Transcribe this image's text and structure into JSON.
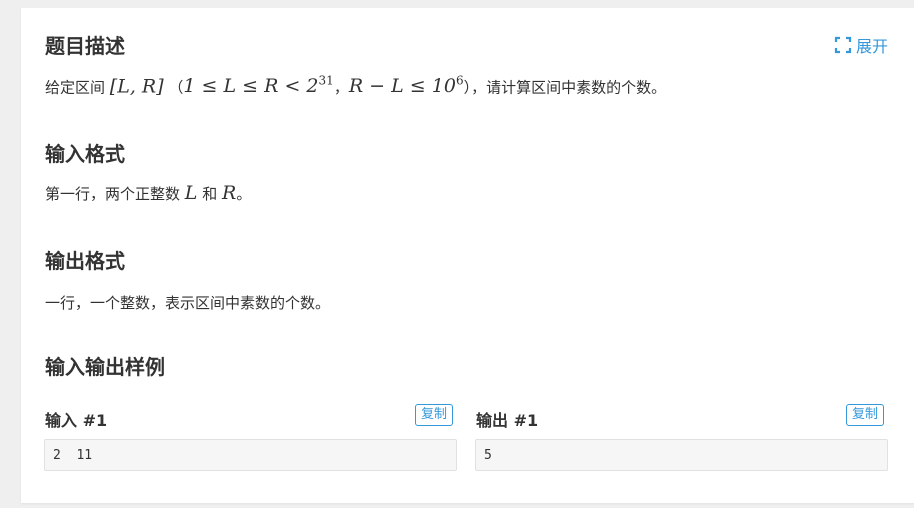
{
  "expand_label": "展开",
  "sections": {
    "description": {
      "title": "题目描述",
      "text_prefix": "给定区间",
      "math_interval": "[L, R]",
      "cond_open": "（",
      "cond_math_1": "1 ≤ L ≤ R < 2",
      "cond_exp_1": "31",
      "cond_sep": "，",
      "cond_math_2": "R − L ≤ 10",
      "cond_exp_2": "6",
      "cond_close": "），",
      "text_suffix": "请计算区间中素数的个数。"
    },
    "input_format": {
      "title": "输入格式",
      "text_prefix": "第一行，两个正整数",
      "var_l": "L",
      "and": "和",
      "var_r": "R",
      "text_suffix": "。"
    },
    "output_format": {
      "title": "输出格式",
      "text": "一行，一个整数，表示区间中素数的个数。"
    },
    "samples": {
      "title": "输入输出样例",
      "input_title": "输入 #1",
      "output_title": "输出 #1",
      "copy_label": "复制",
      "input_value": "2  11",
      "output_value": "5"
    }
  }
}
